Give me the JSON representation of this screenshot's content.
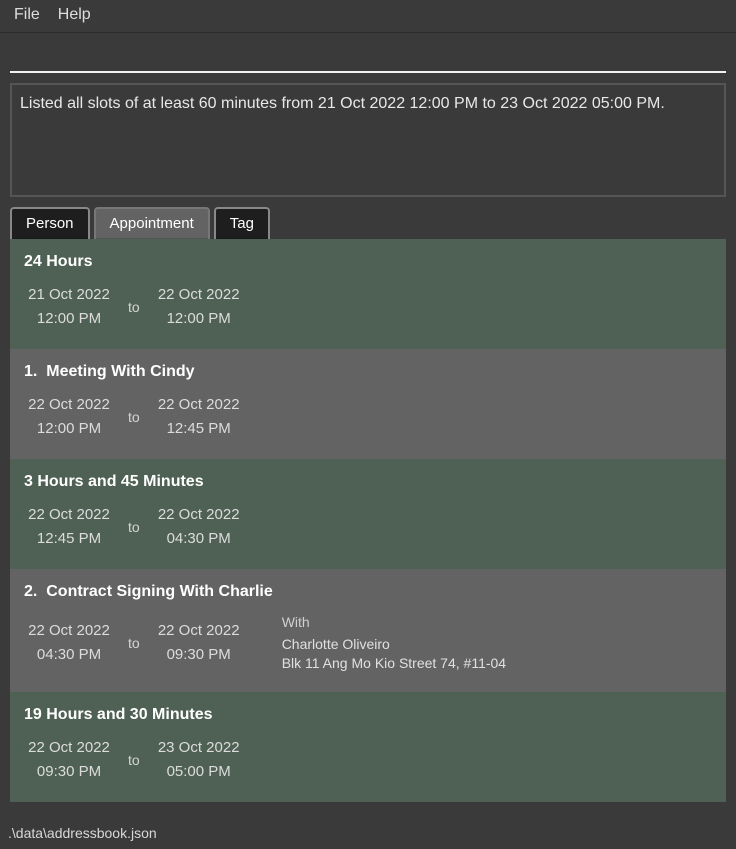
{
  "menu": {
    "file": "File",
    "help": "Help"
  },
  "result_message": "Listed all slots of at least 60 minutes from 21 Oct 2022 12:00 PM to 23 Oct 2022 05:00 PM.",
  "tabs": {
    "person": "Person",
    "appointment": "Appointment",
    "tag": "Tag",
    "active": "Person"
  },
  "to_label": "to",
  "with_label": "With",
  "slots": [
    {
      "kind": "gap",
      "title": "24 Hours",
      "start_date": "21 Oct 2022",
      "start_time": "12:00 PM",
      "end_date": "22 Oct 2022",
      "end_time": "12:00 PM"
    },
    {
      "kind": "appointment",
      "index": "1.",
      "title": "Meeting With Cindy",
      "start_date": "22 Oct 2022",
      "start_time": "12:00 PM",
      "end_date": "22 Oct 2022",
      "end_time": "12:45 PM"
    },
    {
      "kind": "gap",
      "title": "3 Hours and 45 Minutes",
      "start_date": "22 Oct 2022",
      "start_time": "12:45 PM",
      "end_date": "22 Oct 2022",
      "end_time": "04:30 PM"
    },
    {
      "kind": "appointment",
      "index": "2.",
      "title": "Contract Signing With Charlie",
      "start_date": "22 Oct 2022",
      "start_time": "04:30 PM",
      "end_date": "22 Oct 2022",
      "end_time": "09:30 PM",
      "with_name": "Charlotte Oliveiro",
      "with_address": "Blk 11 Ang Mo Kio Street 74, #11-04"
    },
    {
      "kind": "gap",
      "title": "19 Hours and 30 Minutes",
      "start_date": "22 Oct 2022",
      "start_time": "09:30 PM",
      "end_date": "23 Oct 2022",
      "end_time": "05:00 PM"
    }
  ],
  "status_path": ".\\data\\addressbook.json"
}
